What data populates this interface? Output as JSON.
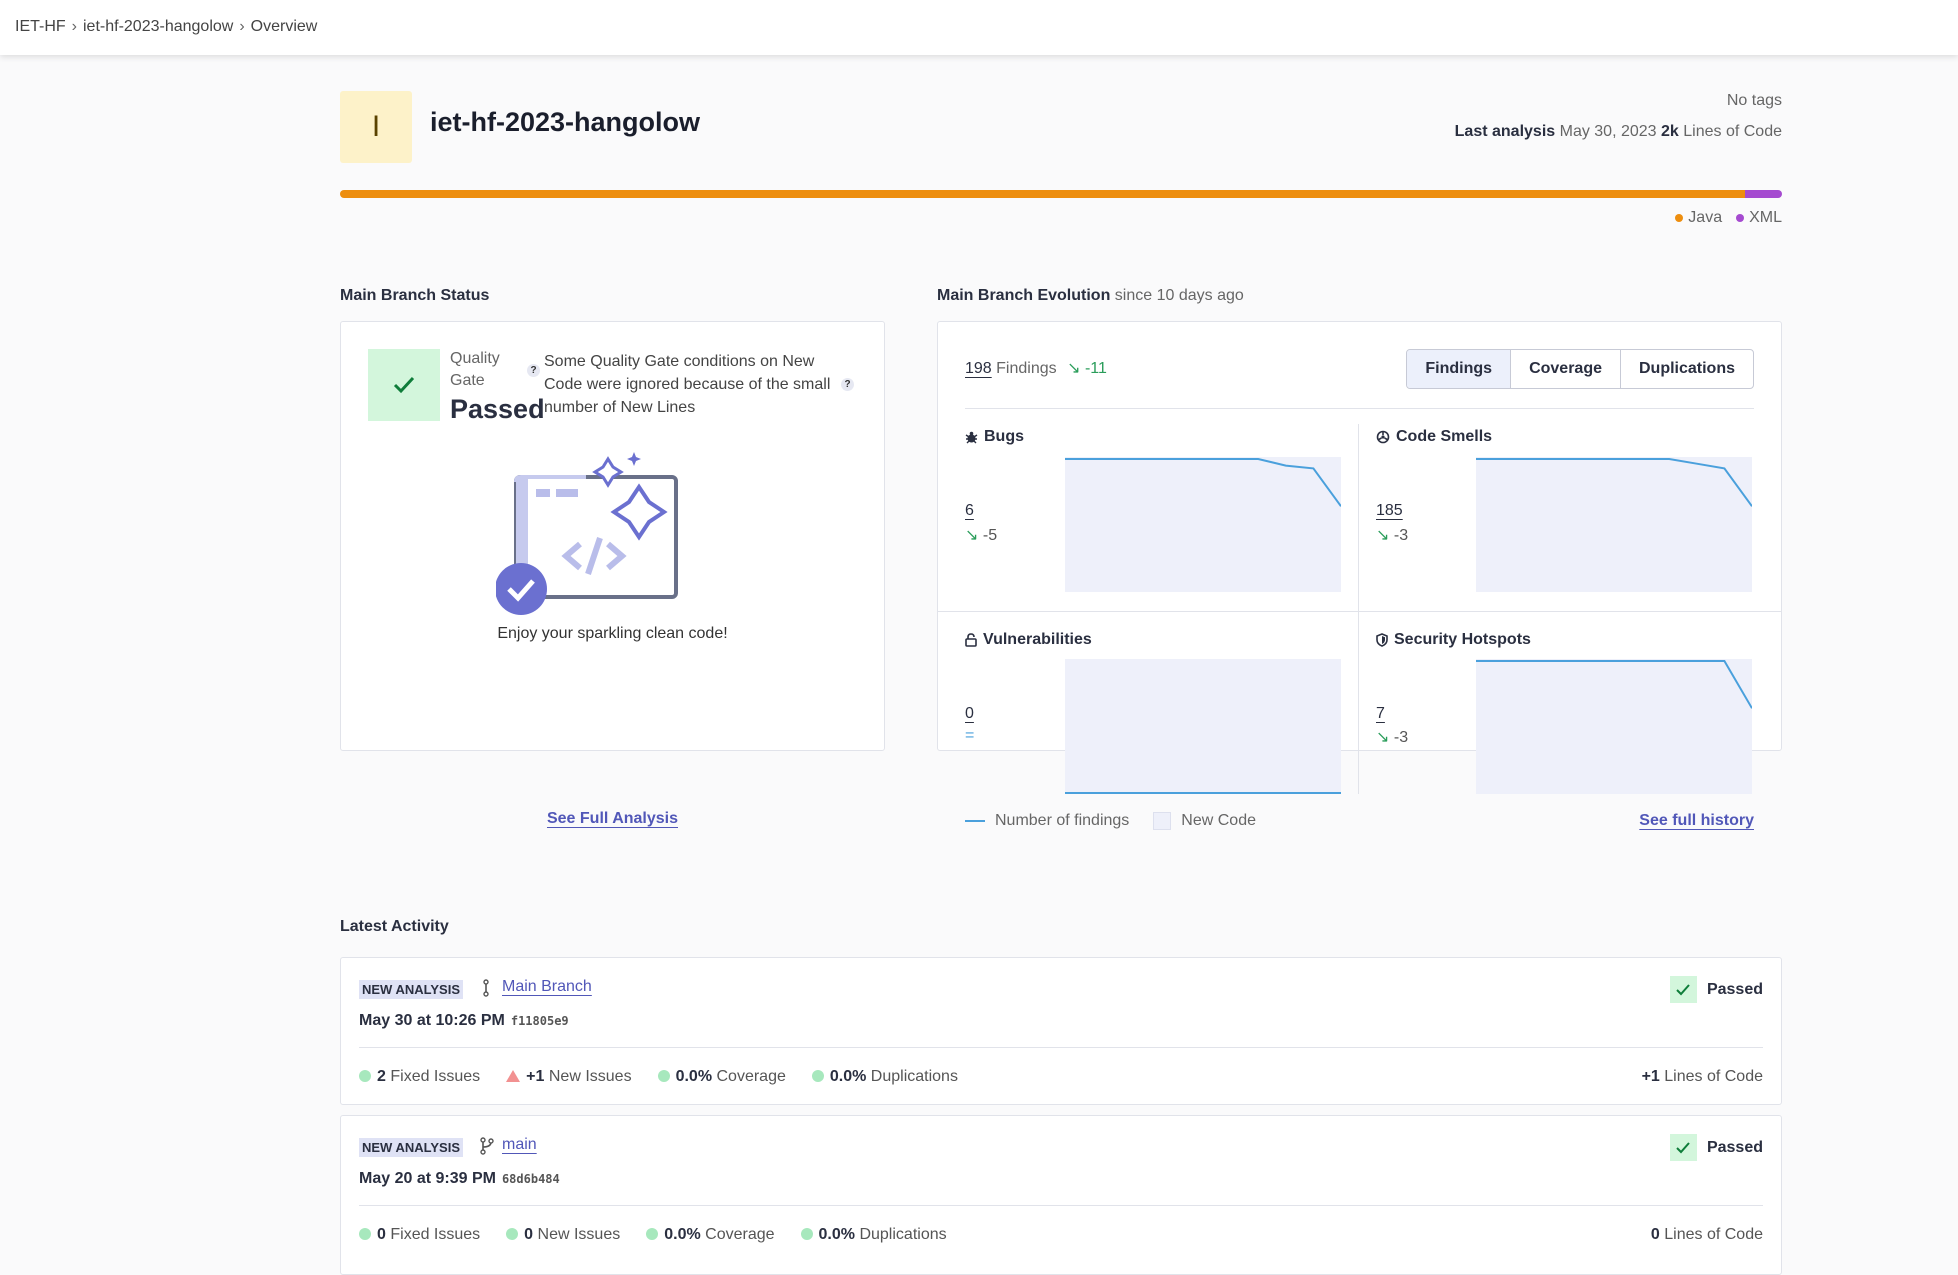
{
  "breadcrumb": {
    "org": "IET-HF",
    "project": "iet-hf-2023-hangolow",
    "page": "Overview"
  },
  "project": {
    "avatar_letter": "I",
    "name": "iet-hf-2023-hangolow",
    "tags": "No tags",
    "last_analysis_label": "Last analysis",
    "last_analysis_date": "May 30, 2023",
    "loc_value": "2k",
    "loc_label": "Lines of Code",
    "languages": [
      {
        "name": "Java",
        "color": "#ed8e0f",
        "share": 0.974
      },
      {
        "name": "XML",
        "color": "#a54ad0",
        "share": 0.026
      }
    ]
  },
  "status": {
    "title": "Main Branch Status",
    "qg_label": "Quality Gate",
    "qg_status": "Passed",
    "qg_note": "Some Quality Gate conditions on New Code were ignored because of the small number of New Lines",
    "help": "?",
    "clean_text": "Enjoy your sparkling clean code!",
    "see_full": "See Full Analysis"
  },
  "evolution": {
    "title": "Main Branch Evolution",
    "since": "since 10 days ago",
    "findings_count": "198",
    "findings_label": "Findings",
    "findings_delta": "-11",
    "tabs": [
      "Findings",
      "Coverage",
      "Duplications"
    ],
    "metrics": {
      "bugs": {
        "title": "Bugs",
        "value": "6",
        "delta": "-5",
        "trend": [
          6,
          6,
          6,
          6,
          6,
          6,
          6,
          6,
          5.3,
          5,
          1
        ]
      },
      "code_smells": {
        "title": "Code Smells",
        "value": "185",
        "delta": "-3",
        "trend": [
          188,
          188,
          188,
          188,
          188,
          188,
          188,
          188,
          187.7,
          187.4,
          185
        ]
      },
      "vulnerabilities": {
        "title": "Vulnerabilities",
        "value": "0",
        "delta": "=",
        "trend": [
          0,
          0,
          0,
          0,
          0,
          0,
          0,
          0,
          0,
          0,
          0
        ]
      },
      "hotspots": {
        "title": "Security Hotspots",
        "value": "7",
        "delta": "-3",
        "trend": [
          10,
          10,
          10,
          10,
          10,
          10,
          10,
          10,
          10,
          10,
          7
        ]
      }
    },
    "legend_findings": "Number of findings",
    "legend_new_code": "New Code",
    "see_history": "See full history"
  },
  "activity": {
    "title": "Latest Activity",
    "items": [
      {
        "badge": "NEW ANALYSIS",
        "branch": "Main Branch",
        "date": "May 30 at 10:26 PM",
        "hash": "f11805e9",
        "status": "Passed",
        "fixed_val": "2",
        "fixed_label": "Fixed Issues",
        "new_val": "+1",
        "new_label": "New Issues",
        "cov_val": "0.0%",
        "cov_label": "Coverage",
        "dup_val": "0.0%",
        "dup_label": "Duplications",
        "loc_val": "+1",
        "loc_label": "Lines of Code"
      },
      {
        "badge": "NEW ANALYSIS",
        "branch": "main",
        "date": "May 20 at 9:39 PM",
        "hash": "68d6b484",
        "status": "Passed",
        "fixed_val": "0",
        "fixed_label": "Fixed Issues",
        "new_val": "0",
        "new_label": "New Issues",
        "cov_val": "0.0%",
        "cov_label": "Coverage",
        "dup_val": "0.0%",
        "dup_label": "Duplications",
        "loc_val": "0",
        "loc_label": "Lines of Code"
      }
    ]
  }
}
